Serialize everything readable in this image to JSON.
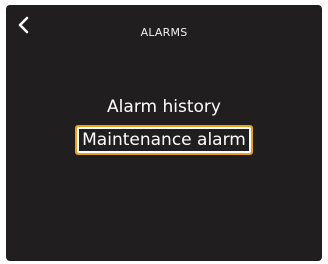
{
  "header": {
    "title": "ALARMS",
    "back_icon": "chevron-left-icon"
  },
  "menu": {
    "items": [
      {
        "label": "Alarm history",
        "selected": false
      },
      {
        "label": "Maintenance alarm",
        "selected": true
      }
    ]
  },
  "colors": {
    "background": "#201e1f",
    "text": "#ffffff",
    "selection_border": "#e4a11b"
  }
}
